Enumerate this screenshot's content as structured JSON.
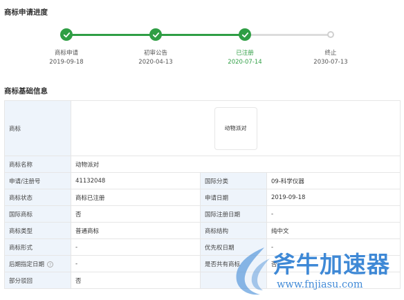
{
  "progress": {
    "title": "商标申请进度",
    "steps": [
      {
        "label": "商标申请",
        "date": "2019-09-18",
        "status": "done"
      },
      {
        "label": "初审公告",
        "date": "2020-04-13",
        "status": "done"
      },
      {
        "label": "已注册",
        "date": "2020-07-14",
        "status": "current"
      },
      {
        "label": "终止",
        "date": "2030-07-13",
        "status": "pending"
      }
    ]
  },
  "basic": {
    "title": "商标基础信息",
    "logo_label": "商标",
    "logo_text": "动物派对",
    "name_label": "商标名称",
    "name_value": "动物派对",
    "rows": [
      {
        "l1": "申请/注册号",
        "v1": "41132048",
        "l2": "国际分类",
        "v2": "09-科学仪器"
      },
      {
        "l1": "商标状态",
        "v1": "商标已注册",
        "l2": "申请日期",
        "v2": "2019-09-18"
      },
      {
        "l1": "国际商标",
        "v1": "否",
        "l2": "国际注册日期",
        "v2": "-"
      },
      {
        "l1": "商标类型",
        "v1": "普通商标",
        "l2": "商标结构",
        "v2": "纯中文"
      },
      {
        "l1": "商标形式",
        "v1": "-",
        "l2": "优先权日期",
        "v2": "-"
      },
      {
        "l1": "后期指定日期",
        "v1": "-",
        "l2": "是否共有商标",
        "v2": "否"
      }
    ],
    "last_label": "部分驳回",
    "last_value": "否"
  },
  "watermark": {
    "brand": "斧牛加速器",
    "url": "www.fnjiasu.com"
  },
  "colors": {
    "accent": "#2f9e44",
    "label_bg": "#eef4fb",
    "watermark": "#2f7fd3"
  }
}
